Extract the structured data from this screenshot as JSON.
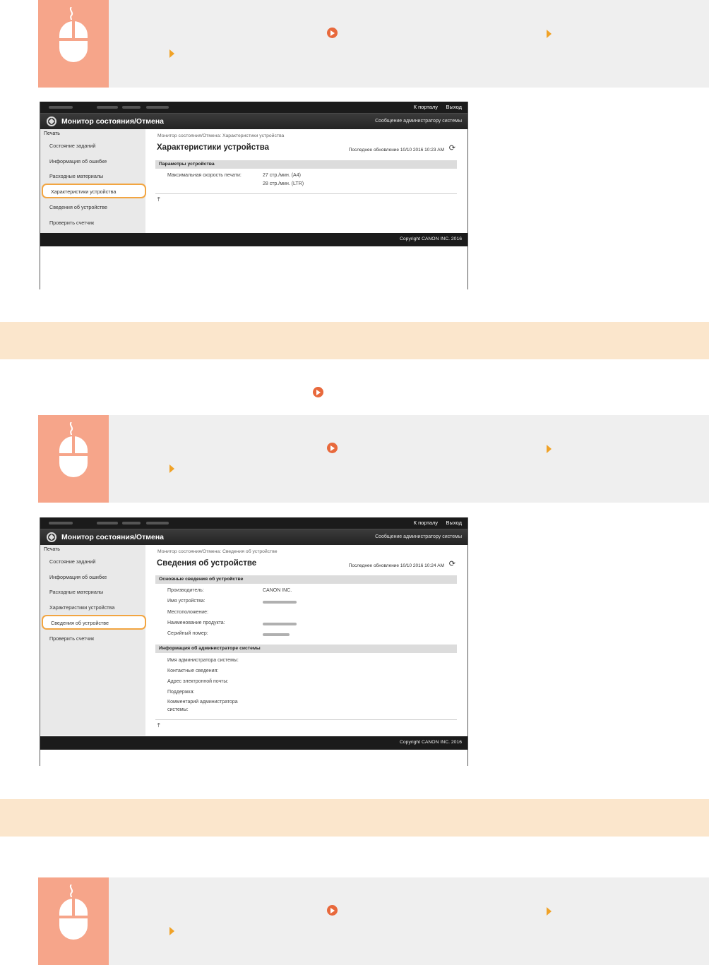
{
  "screen1": {
    "top_links": [
      "К порталу",
      "Выход"
    ],
    "app_title": "Монитор состояния/Отмена",
    "admin_message": "Сообщение администратору системы",
    "sidebar_heading": "Печать",
    "sidebar_items": [
      "Состояние заданий",
      "Информация об ошибке",
      "Расходные материалы",
      "Характеристики устройства",
      "Сведения об устройстве",
      "Проверить счетчик"
    ],
    "selected_item": "Характеристики устройства",
    "breadcrumb": "Монитор состояния/Отмена: Характеристики устройства",
    "page_title": "Характеристики устройства",
    "last_update": "Последнее обновление 10/10 2016 10:23 AM",
    "section": "Параметры устройства",
    "speed_label": "Максимальная скорость печати:",
    "speed_values": [
      "27 стр./мин. (A4)",
      "28 стр./мин. (LTR)"
    ],
    "copyright": "Copyright CANON INC. 2016"
  },
  "screen2": {
    "top_links": [
      "К порталу",
      "Выход"
    ],
    "app_title": "Монитор состояния/Отмена",
    "admin_message": "Сообщение администратору системы",
    "sidebar_heading": "Печать",
    "sidebar_items": [
      "Состояние заданий",
      "Информация об ошибке",
      "Расходные материалы",
      "Характеристики устройства",
      "Сведения об устройстве",
      "Проверить счетчик"
    ],
    "selected_item": "Сведения об устройстве",
    "breadcrumb": "Монитор состояния/Отмена: Сведения об устройстве",
    "page_title": "Сведения об устройстве",
    "last_update": "Последнее обновление 10/10 2016 10:24 AM",
    "section_basic": "Основные сведения об устройстве",
    "basic_labels": [
      "Производитель:",
      "Имя устройства:",
      "Местоположение:",
      "Наименование продукта:",
      "Серийный номер:"
    ],
    "manufacturer": "CANON INC.",
    "section_admin": "Информация об администраторе системы",
    "admin_labels": [
      "Имя администратора системы:",
      "Контактные сведения:",
      "Адрес электронной почты:",
      "Поддержка:",
      "Комментарий администратора",
      "системы:"
    ],
    "copyright": "Copyright CANON INC. 2016"
  },
  "colors": {
    "icon_bg": "#f6a58a",
    "step_bg": "#efefef",
    "section_bar": "#fbe6cc",
    "link_icon": "#e8693c",
    "arrow_icon": "#f0a227",
    "highlight": "#f2a541"
  },
  "icons": [
    "mouse-icon",
    "link-circle-icon",
    "arrow-right-icon",
    "refresh-icon",
    "to-top-icon"
  ]
}
